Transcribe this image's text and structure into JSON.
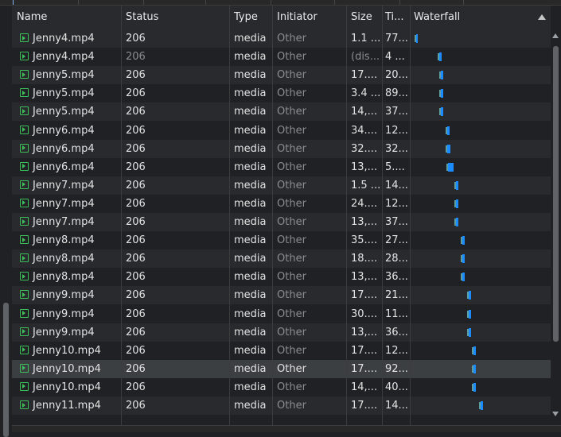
{
  "columns": {
    "name": "Name",
    "status": "Status",
    "type": "Type",
    "initiator": "Initiator",
    "size": "Size",
    "time": "Ti...",
    "waterfall": "Waterfall"
  },
  "rows": [
    {
      "name": "Jenny4.mp4",
      "status": "206",
      "type": "media",
      "initiator": "Other",
      "size": "1.1 ...",
      "time": "77...",
      "wf": 0.01,
      "bar": 2
    },
    {
      "name": "Jenny4.mp4",
      "status": "206",
      "type": "media",
      "initiator": "Other",
      "size": "(dis...",
      "time": "4 ...",
      "wf": 0.2,
      "bar": 3,
      "status_muted": true
    },
    {
      "name": "Jenny5.mp4",
      "status": "206",
      "type": "media",
      "initiator": "Other",
      "size": "17....",
      "time": "20...",
      "wf": 0.21,
      "bar": 3
    },
    {
      "name": "Jenny5.mp4",
      "status": "206",
      "type": "media",
      "initiator": "Other",
      "size": "3.4 ...",
      "time": "89...",
      "wf": 0.21,
      "bar": 3
    },
    {
      "name": "Jenny5.mp4",
      "status": "206",
      "type": "media",
      "initiator": "Other",
      "size": "14,...",
      "time": "37...",
      "wf": 0.21,
      "bar": 3
    },
    {
      "name": "Jenny6.mp4",
      "status": "206",
      "type": "media",
      "initiator": "Other",
      "size": "34....",
      "time": "12...",
      "wf": 0.26,
      "bar": 3
    },
    {
      "name": "Jenny6.mp4",
      "status": "206",
      "type": "media",
      "initiator": "Other",
      "size": "32....",
      "time": "32...",
      "wf": 0.26,
      "bar": 4
    },
    {
      "name": "Jenny6.mp4",
      "status": "206",
      "type": "media",
      "initiator": "Other",
      "size": "13,...",
      "time": "5....",
      "wf": 0.27,
      "bar": 7
    },
    {
      "name": "Jenny7.mp4",
      "status": "206",
      "type": "media",
      "initiator": "Other",
      "size": "1.5 ...",
      "time": "14...",
      "wf": 0.33,
      "bar": 3
    },
    {
      "name": "Jenny7.mp4",
      "status": "206",
      "type": "media",
      "initiator": "Other",
      "size": "24....",
      "time": "12...",
      "wf": 0.33,
      "bar": 3
    },
    {
      "name": "Jenny7.mp4",
      "status": "206",
      "type": "media",
      "initiator": "Other",
      "size": "13,...",
      "time": "37...",
      "wf": 0.33,
      "bar": 3
    },
    {
      "name": "Jenny8.mp4",
      "status": "206",
      "type": "media",
      "initiator": "Other",
      "size": "35....",
      "time": "27...",
      "wf": 0.38,
      "bar": 3
    },
    {
      "name": "Jenny8.mp4",
      "status": "206",
      "type": "media",
      "initiator": "Other",
      "size": "18....",
      "time": "28...",
      "wf": 0.38,
      "bar": 3
    },
    {
      "name": "Jenny8.mp4",
      "status": "206",
      "type": "media",
      "initiator": "Other",
      "size": "13,...",
      "time": "36...",
      "wf": 0.38,
      "bar": 3
    },
    {
      "name": "Jenny9.mp4",
      "status": "206",
      "type": "media",
      "initiator": "Other",
      "size": "17....",
      "time": "21...",
      "wf": 0.43,
      "bar": 3
    },
    {
      "name": "Jenny9.mp4",
      "status": "206",
      "type": "media",
      "initiator": "Other",
      "size": "30....",
      "time": "11...",
      "wf": 0.43,
      "bar": 3
    },
    {
      "name": "Jenny9.mp4",
      "status": "206",
      "type": "media",
      "initiator": "Other",
      "size": "13,...",
      "time": "36...",
      "wf": 0.43,
      "bar": 3
    },
    {
      "name": "Jenny10.mp4",
      "status": "206",
      "type": "media",
      "initiator": "Other",
      "size": "17....",
      "time": "12...",
      "wf": 0.47,
      "bar": 3
    },
    {
      "name": "Jenny10.mp4",
      "status": "206",
      "type": "media",
      "initiator": "Other",
      "size": "17....",
      "time": "92...",
      "wf": 0.47,
      "bar": 3,
      "selected": true
    },
    {
      "name": "Jenny10.mp4",
      "status": "206",
      "type": "media",
      "initiator": "Other",
      "size": "14,...",
      "time": "40...",
      "wf": 0.47,
      "bar": 3
    },
    {
      "name": "Jenny11.mp4",
      "status": "206",
      "type": "media",
      "initiator": "Other",
      "size": "17....",
      "time": "14...",
      "wf": 0.53,
      "bar": 3
    }
  ],
  "colors": {
    "row_even": "#202124",
    "row_odd": "#292a2d",
    "row_selected": "#3c3f42",
    "icon_media": "#3fbf5a",
    "bar_blue": "#1a8cff"
  },
  "icons": {
    "row_icon": "media-file-icon",
    "sort": "sort-ascending-icon"
  }
}
